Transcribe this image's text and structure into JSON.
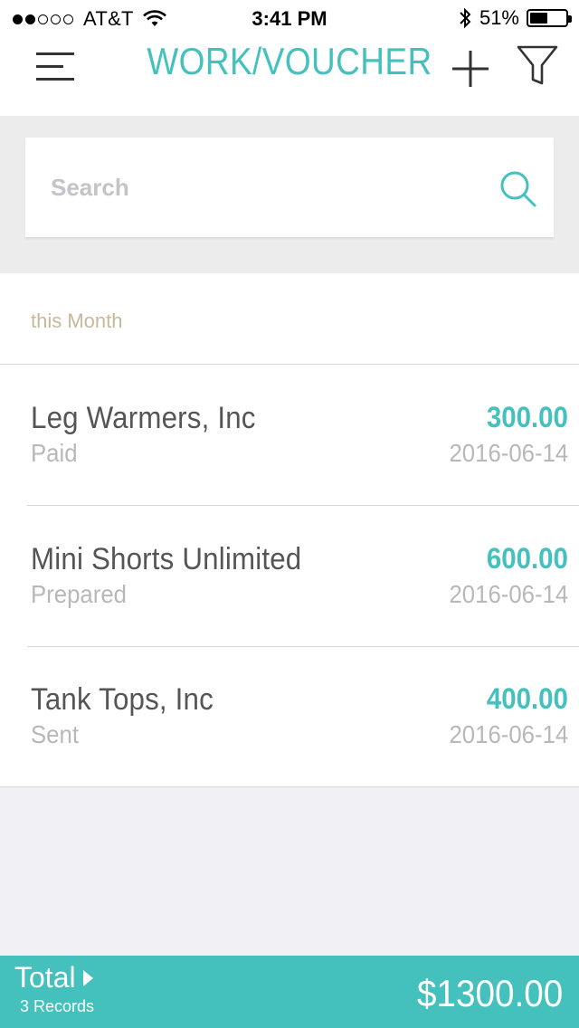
{
  "status_bar": {
    "carrier": "AT&T",
    "time": "3:41 PM",
    "battery_percent": "51%",
    "battery_level": 0.51,
    "signal_bars_filled": 2,
    "signal_bars_total": 5
  },
  "nav": {
    "title": "WORK/VOUCHER",
    "menu_icon": "hamburger-menu-icon",
    "add_icon": "plus-icon",
    "filter_icon": "funnel-filter-icon"
  },
  "search": {
    "placeholder": "Search",
    "value": ""
  },
  "list": {
    "section_label": "this Month",
    "items": [
      {
        "name": "Leg Warmers, Inc",
        "status": "Paid",
        "amount": "300.00",
        "date": "2016-06-14"
      },
      {
        "name": "Mini Shorts Unlimited",
        "status": "Prepared",
        "amount": "600.00",
        "date": "2016-06-14"
      },
      {
        "name": "Tank Tops, Inc",
        "status": "Sent",
        "amount": "400.00",
        "date": "2016-06-14"
      }
    ]
  },
  "footer": {
    "total_label": "Total",
    "records": "3 Records",
    "total_amount": "$1300.00"
  },
  "colors": {
    "accent": "#44c1bd",
    "section_label": "#c8b89a",
    "muted_text": "#b8b8b8",
    "background": "#efeff4"
  }
}
